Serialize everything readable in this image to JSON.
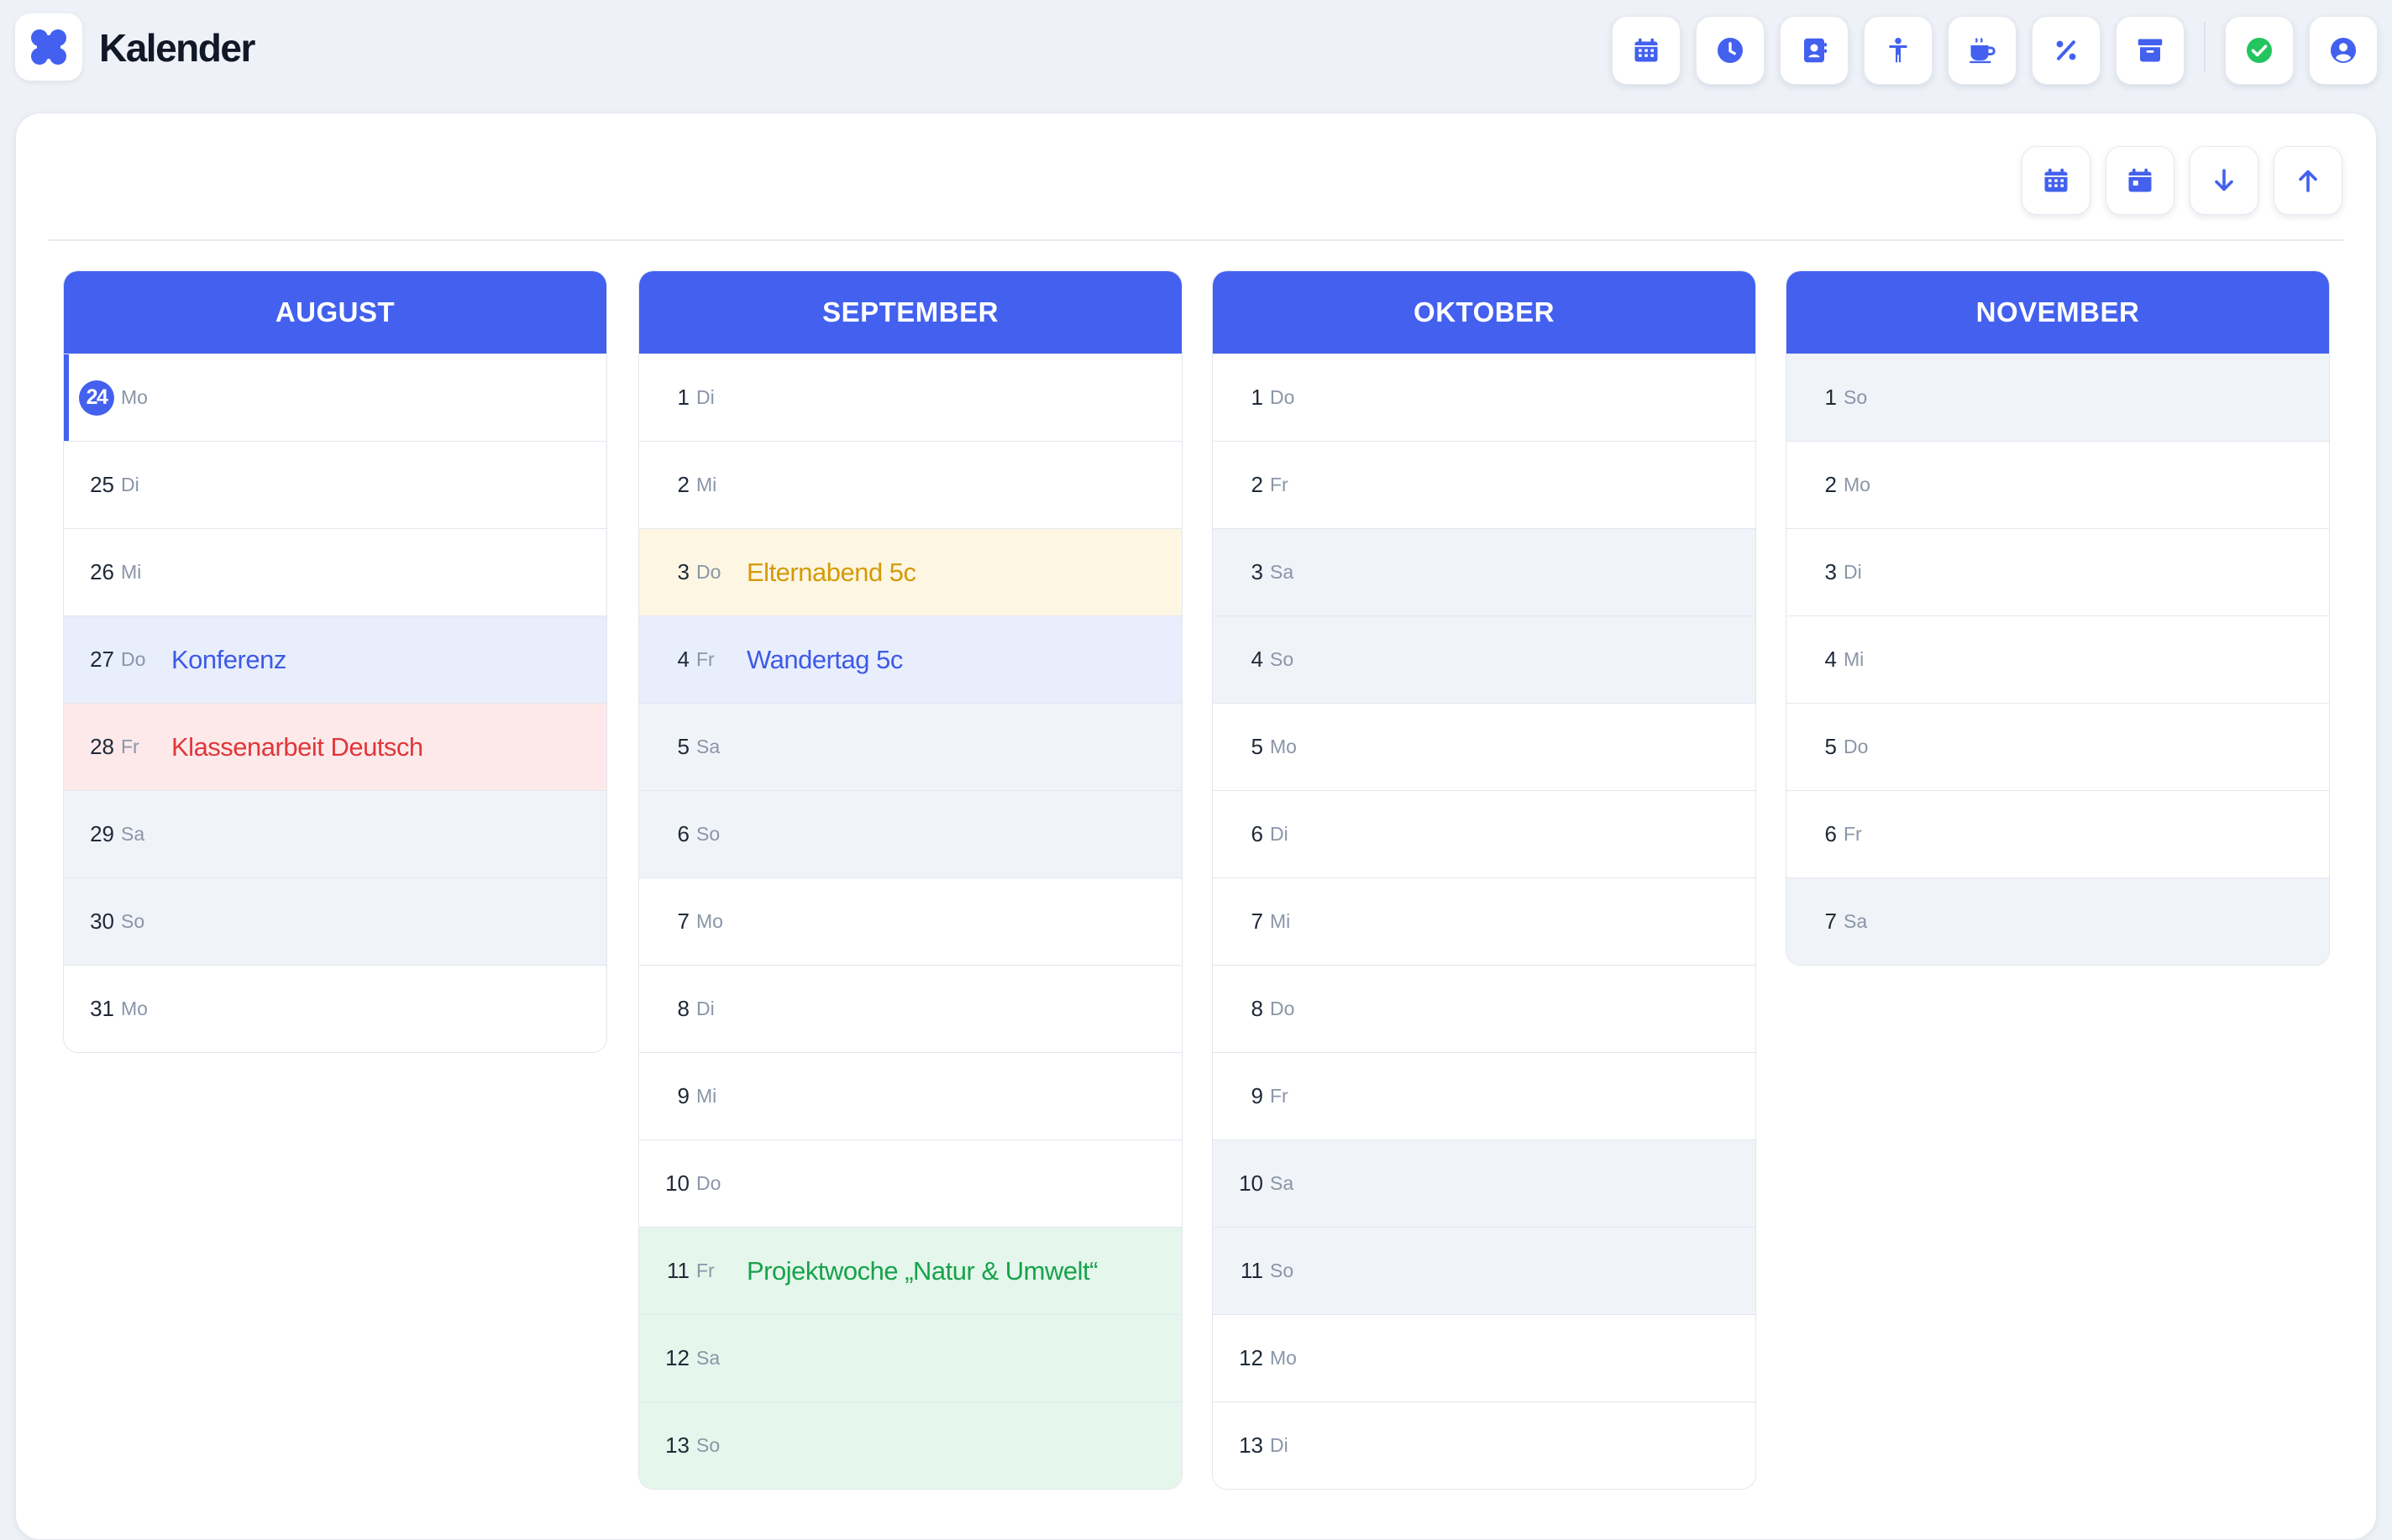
{
  "app": {
    "title": "Kalender",
    "accent": "#4361ee"
  },
  "toolbar": {
    "buttons": [
      {
        "name": "calendar-icon"
      },
      {
        "name": "clock-icon"
      },
      {
        "name": "contacts-icon"
      },
      {
        "name": "person-icon"
      },
      {
        "name": "coffee-icon"
      },
      {
        "name": "percent-icon"
      },
      {
        "name": "archive-icon"
      },
      {
        "name": "check-circle-icon"
      },
      {
        "name": "user-circle-icon"
      }
    ]
  },
  "view_controls": [
    {
      "name": "calendar-grid-icon"
    },
    {
      "name": "calendar-day-icon"
    },
    {
      "name": "arrow-down-icon"
    },
    {
      "name": "arrow-up-icon"
    }
  ],
  "months": [
    {
      "name": "AUGUST",
      "days": [
        {
          "num": "24",
          "wd": "Mo",
          "today": true
        },
        {
          "num": "25",
          "wd": "Di"
        },
        {
          "num": "26",
          "wd": "Mi"
        },
        {
          "num": "27",
          "wd": "Do",
          "event": "Konferenz",
          "color": "blue"
        },
        {
          "num": "28",
          "wd": "Fr",
          "event": "Klassenarbeit Deutsch",
          "color": "red"
        },
        {
          "num": "29",
          "wd": "Sa",
          "weekend": true
        },
        {
          "num": "30",
          "wd": "So",
          "weekend": true
        },
        {
          "num": "31",
          "wd": "Mo"
        }
      ]
    },
    {
      "name": "SEPTEMBER",
      "days": [
        {
          "num": "1",
          "wd": "Di"
        },
        {
          "num": "2",
          "wd": "Mi"
        },
        {
          "num": "3",
          "wd": "Do",
          "event": "Elternabend 5c",
          "color": "yellow"
        },
        {
          "num": "4",
          "wd": "Fr",
          "event": "Wandertag 5c",
          "color": "blue"
        },
        {
          "num": "5",
          "wd": "Sa",
          "weekend": true
        },
        {
          "num": "6",
          "wd": "So",
          "weekend": true
        },
        {
          "num": "7",
          "wd": "Mo"
        },
        {
          "num": "8",
          "wd": "Di"
        },
        {
          "num": "9",
          "wd": "Mi"
        },
        {
          "num": "10",
          "wd": "Do"
        },
        {
          "num": "11",
          "wd": "Fr",
          "event": "Projektwoche „Natur & Umwelt“",
          "color": "green"
        },
        {
          "num": "12",
          "wd": "Sa",
          "color": "green"
        },
        {
          "num": "13",
          "wd": "So",
          "color": "green"
        }
      ]
    },
    {
      "name": "OKTOBER",
      "days": [
        {
          "num": "1",
          "wd": "Do"
        },
        {
          "num": "2",
          "wd": "Fr"
        },
        {
          "num": "3",
          "wd": "Sa",
          "weekend": true
        },
        {
          "num": "4",
          "wd": "So",
          "weekend": true
        },
        {
          "num": "5",
          "wd": "Mo"
        },
        {
          "num": "6",
          "wd": "Di"
        },
        {
          "num": "7",
          "wd": "Mi"
        },
        {
          "num": "8",
          "wd": "Do"
        },
        {
          "num": "9",
          "wd": "Fr"
        },
        {
          "num": "10",
          "wd": "Sa",
          "weekend": true
        },
        {
          "num": "11",
          "wd": "So",
          "weekend": true
        },
        {
          "num": "12",
          "wd": "Mo"
        },
        {
          "num": "13",
          "wd": "Di"
        }
      ]
    },
    {
      "name": "NOVEMBER",
      "days": [
        {
          "num": "1",
          "wd": "So",
          "weekend": true
        },
        {
          "num": "2",
          "wd": "Mo"
        },
        {
          "num": "3",
          "wd": "Di"
        },
        {
          "num": "4",
          "wd": "Mi"
        },
        {
          "num": "5",
          "wd": "Do"
        },
        {
          "num": "6",
          "wd": "Fr"
        },
        {
          "num": "7",
          "wd": "Sa",
          "weekend": true
        }
      ]
    }
  ]
}
